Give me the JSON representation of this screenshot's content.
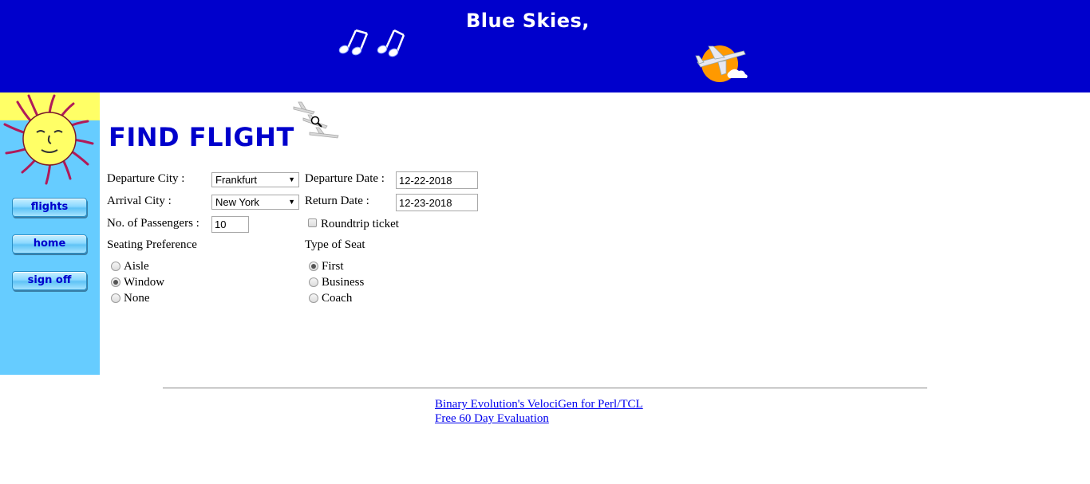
{
  "header": {
    "title": "Blue Skies,",
    "background_color": "#0000cc"
  },
  "sidebar": {
    "background_color": "#66ccff",
    "logo": "sun-face-icon",
    "nav": [
      {
        "label": "flights"
      },
      {
        "label": "home"
      },
      {
        "label": "sign off"
      }
    ]
  },
  "main": {
    "title": "FIND FLIGHT",
    "title_color": "#0000cc",
    "form": {
      "departure_city": {
        "label": "Departure City :",
        "value": "Frankfurt"
      },
      "arrival_city": {
        "label": "Arrival City :",
        "value": "New York"
      },
      "passengers": {
        "label": "No. of Passengers :",
        "value": "10"
      },
      "departure_date": {
        "label": "Departure Date :",
        "value": "12-22-2018"
      },
      "return_date": {
        "label": "Return Date :",
        "value": "12-23-2018"
      },
      "roundtrip": {
        "label": "Roundtrip ticket",
        "checked": false
      },
      "seating": {
        "label": "Seating Preference",
        "options": [
          {
            "label": "Aisle",
            "checked": false
          },
          {
            "label": "Window",
            "checked": true
          },
          {
            "label": "None",
            "checked": false
          }
        ]
      },
      "seat_type": {
        "label": "Type of Seat",
        "options": [
          {
            "label": "First",
            "checked": true
          },
          {
            "label": "Business",
            "checked": false
          },
          {
            "label": "Coach",
            "checked": false
          }
        ]
      }
    }
  },
  "footer": {
    "link1": "Binary Evolution's VelociGen for Perl/TCL",
    "link2": "Free 60 Day Evaluation",
    "link_color": "#0000ee"
  }
}
